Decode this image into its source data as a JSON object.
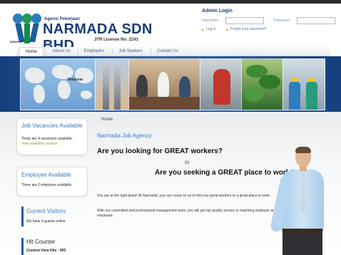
{
  "header": {
    "agency_sub": "Agensi Pekerjaan",
    "agency_name": "NARMADA SDN BHD",
    "license": "JTR License No: 2241",
    "registration": "698191-H"
  },
  "login": {
    "title": "Admin Login",
    "username_label": "Username",
    "password_label": "Password",
    "username_value": "",
    "password_value": "",
    "login_link": "Log in",
    "forgot_link": "Forgot your password?"
  },
  "nav": {
    "items": [
      {
        "label": "Home",
        "active": true
      },
      {
        "label": "About Us",
        "active": false
      },
      {
        "label": "Employers",
        "active": false
      },
      {
        "label": "Job Seekers",
        "active": false
      },
      {
        "label": "Contact Us",
        "active": false
      }
    ]
  },
  "banner": {
    "map_label": "Malaysia"
  },
  "sidebar": {
    "vacancies": {
      "title": "Job Vacancies Available",
      "text": "There are 4 vacancies available.",
      "link": "View available position"
    },
    "employees": {
      "title": "Employee Available",
      "text": "There are 2 employee available."
    },
    "visitors": {
      "title": "Current Visitors",
      "text": "We have 4 guests online"
    },
    "counter": {
      "title": "Hit Counter",
      "text": "Content View Hits : 950"
    }
  },
  "main": {
    "breadcrumb": "Home",
    "title": "Narmada Job Agency",
    "heading_workers": "Are you looking for GREAT workers?",
    "or_text": "Or",
    "heading_seek": "Are you seeking a GREAT place to work?",
    "para1": "You are at the right place! At Narmada, you can count on us to find you great workers or a great place to work.",
    "para2": "With our committed and professional management team, you will get top quality service in matching employer and employee."
  },
  "colors": {
    "brand_blue": "#1b3d78",
    "link_blue": "#3b78b9",
    "accent_green": "#7aa83b",
    "banner_blue": "#2b64b0"
  }
}
